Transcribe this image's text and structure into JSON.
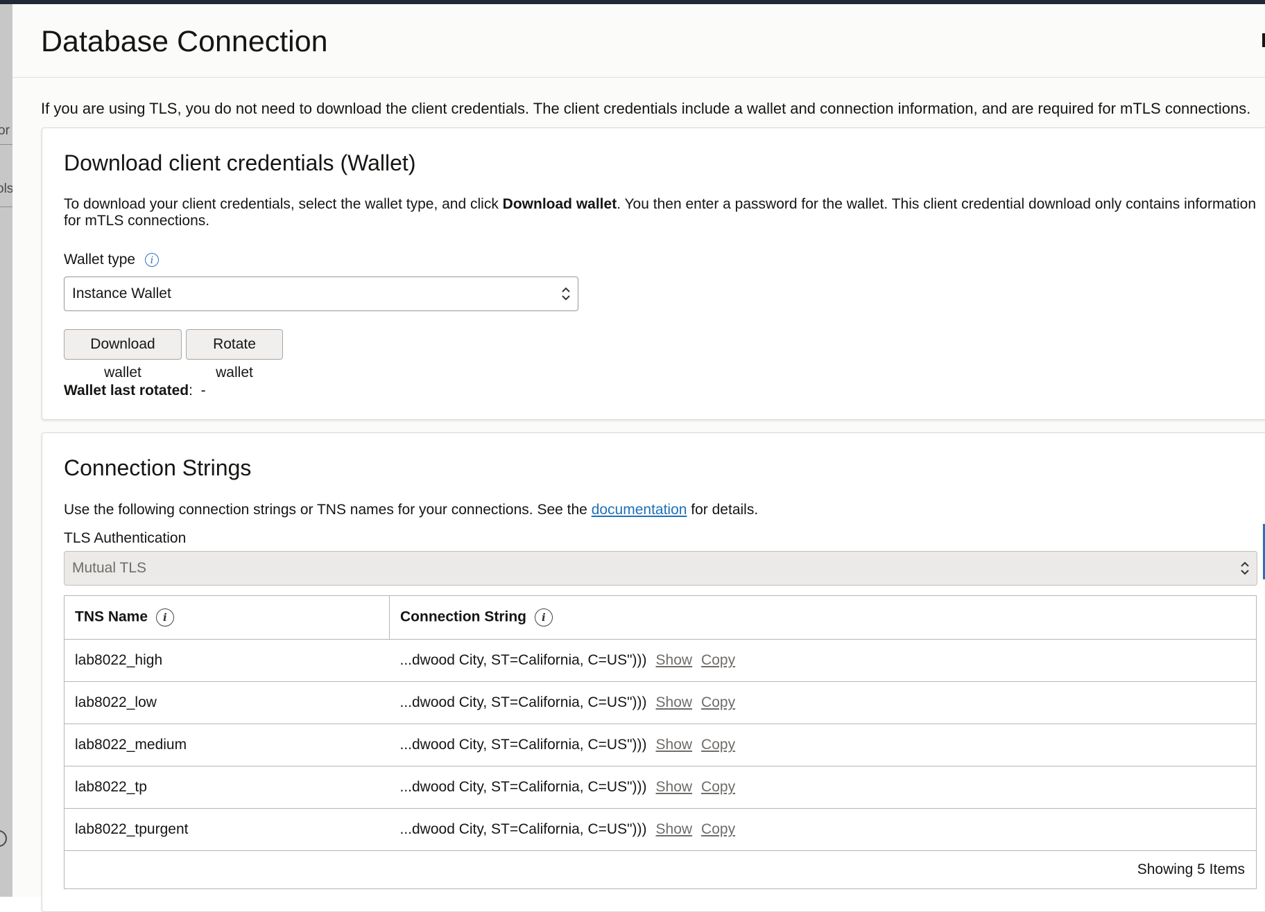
{
  "panel": {
    "title": "Database Connection",
    "intro": "If you are using TLS, you do not need to download the client credentials. The client credentials include a wallet and connection information, and are required for mTLS connections."
  },
  "left_strip": {
    "fragment_1": "or",
    "fragment_2": "ols"
  },
  "wallet_section": {
    "title": "Download client credentials (Wallet)",
    "desc_before": "To download your client credentials, select the wallet type, and click ",
    "desc_bold": "Download wallet",
    "desc_after": ". You then enter a password for the wallet. This client credential download only contains information for mTLS connections.",
    "wallet_type_label": "Wallet type",
    "wallet_type_value": "Instance Wallet",
    "download_button": "Download wallet",
    "rotate_button": "Rotate wallet",
    "last_rotated_label": "Wallet last rotated",
    "last_rotated_value": "-"
  },
  "connection_section": {
    "title": "Connection Strings",
    "desc_before": "Use the following connection strings or TNS names for your connections. See the ",
    "desc_link": "documentation",
    "desc_after": " for details.",
    "tls_label": "TLS Authentication",
    "tls_value": "Mutual TLS",
    "table": {
      "headers": [
        "TNS Name",
        "Connection String"
      ],
      "rows": [
        {
          "name": "lab8022_high",
          "conn": "...dwood City, ST=California, C=US\")))",
          "show": "Show",
          "copy": "Copy"
        },
        {
          "name": "lab8022_low",
          "conn": "...dwood City, ST=California, C=US\")))",
          "show": "Show",
          "copy": "Copy"
        },
        {
          "name": "lab8022_medium",
          "conn": "...dwood City, ST=California, C=US\")))",
          "show": "Show",
          "copy": "Copy"
        },
        {
          "name": "lab8022_tp",
          "conn": "...dwood City, ST=California, C=US\")))",
          "show": "Show",
          "copy": "Copy"
        },
        {
          "name": "lab8022_tpurgent",
          "conn": "...dwood City, ST=California, C=US\")))",
          "show": "Show",
          "copy": "Copy"
        }
      ],
      "footer": "Showing 5 Items"
    }
  },
  "icons": {
    "info": "info-icon",
    "select_chevron": "chevron-up-down-icon"
  }
}
